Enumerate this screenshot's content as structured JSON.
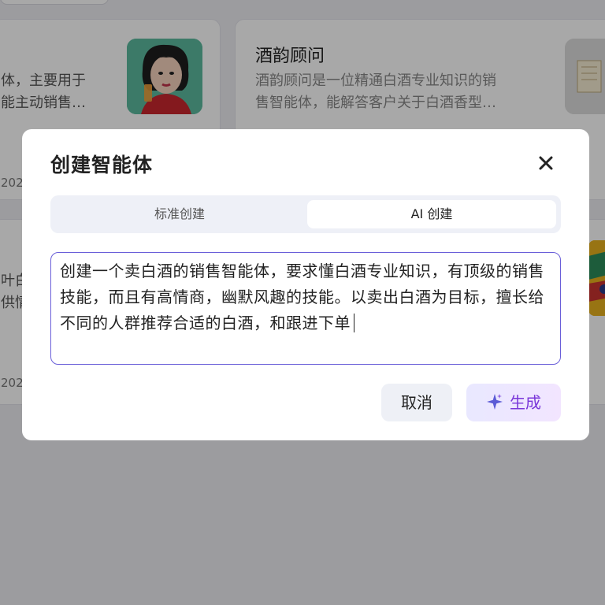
{
  "background": {
    "left_card": {
      "desc_line1": "体，主要用于",
      "desc_line2": "能主动销售…",
      "date_fragment": "202"
    },
    "right_card": {
      "title": "酒韵顾问",
      "desc_line1": "酒韵顾问是一位精通白酒专业知识的销",
      "desc_line2": "售智能体，能解答客户关于白酒香型…"
    },
    "lower_left_card": {
      "desc_line1": "叶白",
      "desc_line2": "供情",
      "date_fragment": "202"
    }
  },
  "modal": {
    "title": "创建智能体",
    "close_icon": "close-icon",
    "tabs": [
      {
        "label": "标准创建",
        "selected": false
      },
      {
        "label": "AI 创建",
        "selected": true
      }
    ],
    "prompt_text": "创建一个卖白酒的销售智能体，要求懂白酒专业知识，有顶级的销售技能，而且有高情商，幽默风趣的技能。以卖出白酒为目标，擅长给不同的人群推荐合适的白酒，和跟进下单",
    "cancel_label": "取消",
    "generate_label": "生成",
    "generate_icon": "sparkle-icon",
    "accent_color": "#6a5fd9"
  }
}
